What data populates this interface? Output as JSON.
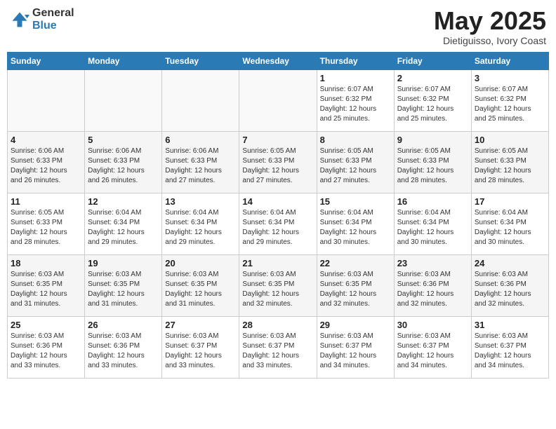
{
  "header": {
    "logo_general": "General",
    "logo_blue": "Blue",
    "month_title": "May 2025",
    "location": "Dietiguisso, Ivory Coast"
  },
  "days_of_week": [
    "Sunday",
    "Monday",
    "Tuesday",
    "Wednesday",
    "Thursday",
    "Friday",
    "Saturday"
  ],
  "weeks": [
    [
      {
        "day": "",
        "info": ""
      },
      {
        "day": "",
        "info": ""
      },
      {
        "day": "",
        "info": ""
      },
      {
        "day": "",
        "info": ""
      },
      {
        "day": "1",
        "info": "Sunrise: 6:07 AM\nSunset: 6:32 PM\nDaylight: 12 hours\nand 25 minutes."
      },
      {
        "day": "2",
        "info": "Sunrise: 6:07 AM\nSunset: 6:32 PM\nDaylight: 12 hours\nand 25 minutes."
      },
      {
        "day": "3",
        "info": "Sunrise: 6:07 AM\nSunset: 6:32 PM\nDaylight: 12 hours\nand 25 minutes."
      }
    ],
    [
      {
        "day": "4",
        "info": "Sunrise: 6:06 AM\nSunset: 6:33 PM\nDaylight: 12 hours\nand 26 minutes."
      },
      {
        "day": "5",
        "info": "Sunrise: 6:06 AM\nSunset: 6:33 PM\nDaylight: 12 hours\nand 26 minutes."
      },
      {
        "day": "6",
        "info": "Sunrise: 6:06 AM\nSunset: 6:33 PM\nDaylight: 12 hours\nand 27 minutes."
      },
      {
        "day": "7",
        "info": "Sunrise: 6:05 AM\nSunset: 6:33 PM\nDaylight: 12 hours\nand 27 minutes."
      },
      {
        "day": "8",
        "info": "Sunrise: 6:05 AM\nSunset: 6:33 PM\nDaylight: 12 hours\nand 27 minutes."
      },
      {
        "day": "9",
        "info": "Sunrise: 6:05 AM\nSunset: 6:33 PM\nDaylight: 12 hours\nand 28 minutes."
      },
      {
        "day": "10",
        "info": "Sunrise: 6:05 AM\nSunset: 6:33 PM\nDaylight: 12 hours\nand 28 minutes."
      }
    ],
    [
      {
        "day": "11",
        "info": "Sunrise: 6:05 AM\nSunset: 6:33 PM\nDaylight: 12 hours\nand 28 minutes."
      },
      {
        "day": "12",
        "info": "Sunrise: 6:04 AM\nSunset: 6:34 PM\nDaylight: 12 hours\nand 29 minutes."
      },
      {
        "day": "13",
        "info": "Sunrise: 6:04 AM\nSunset: 6:34 PM\nDaylight: 12 hours\nand 29 minutes."
      },
      {
        "day": "14",
        "info": "Sunrise: 6:04 AM\nSunset: 6:34 PM\nDaylight: 12 hours\nand 29 minutes."
      },
      {
        "day": "15",
        "info": "Sunrise: 6:04 AM\nSunset: 6:34 PM\nDaylight: 12 hours\nand 30 minutes."
      },
      {
        "day": "16",
        "info": "Sunrise: 6:04 AM\nSunset: 6:34 PM\nDaylight: 12 hours\nand 30 minutes."
      },
      {
        "day": "17",
        "info": "Sunrise: 6:04 AM\nSunset: 6:34 PM\nDaylight: 12 hours\nand 30 minutes."
      }
    ],
    [
      {
        "day": "18",
        "info": "Sunrise: 6:03 AM\nSunset: 6:35 PM\nDaylight: 12 hours\nand 31 minutes."
      },
      {
        "day": "19",
        "info": "Sunrise: 6:03 AM\nSunset: 6:35 PM\nDaylight: 12 hours\nand 31 minutes."
      },
      {
        "day": "20",
        "info": "Sunrise: 6:03 AM\nSunset: 6:35 PM\nDaylight: 12 hours\nand 31 minutes."
      },
      {
        "day": "21",
        "info": "Sunrise: 6:03 AM\nSunset: 6:35 PM\nDaylight: 12 hours\nand 32 minutes."
      },
      {
        "day": "22",
        "info": "Sunrise: 6:03 AM\nSunset: 6:35 PM\nDaylight: 12 hours\nand 32 minutes."
      },
      {
        "day": "23",
        "info": "Sunrise: 6:03 AM\nSunset: 6:36 PM\nDaylight: 12 hours\nand 32 minutes."
      },
      {
        "day": "24",
        "info": "Sunrise: 6:03 AM\nSunset: 6:36 PM\nDaylight: 12 hours\nand 32 minutes."
      }
    ],
    [
      {
        "day": "25",
        "info": "Sunrise: 6:03 AM\nSunset: 6:36 PM\nDaylight: 12 hours\nand 33 minutes."
      },
      {
        "day": "26",
        "info": "Sunrise: 6:03 AM\nSunset: 6:36 PM\nDaylight: 12 hours\nand 33 minutes."
      },
      {
        "day": "27",
        "info": "Sunrise: 6:03 AM\nSunset: 6:37 PM\nDaylight: 12 hours\nand 33 minutes."
      },
      {
        "day": "28",
        "info": "Sunrise: 6:03 AM\nSunset: 6:37 PM\nDaylight: 12 hours\nand 33 minutes."
      },
      {
        "day": "29",
        "info": "Sunrise: 6:03 AM\nSunset: 6:37 PM\nDaylight: 12 hours\nand 34 minutes."
      },
      {
        "day": "30",
        "info": "Sunrise: 6:03 AM\nSunset: 6:37 PM\nDaylight: 12 hours\nand 34 minutes."
      },
      {
        "day": "31",
        "info": "Sunrise: 6:03 AM\nSunset: 6:37 PM\nDaylight: 12 hours\nand 34 minutes."
      }
    ]
  ]
}
